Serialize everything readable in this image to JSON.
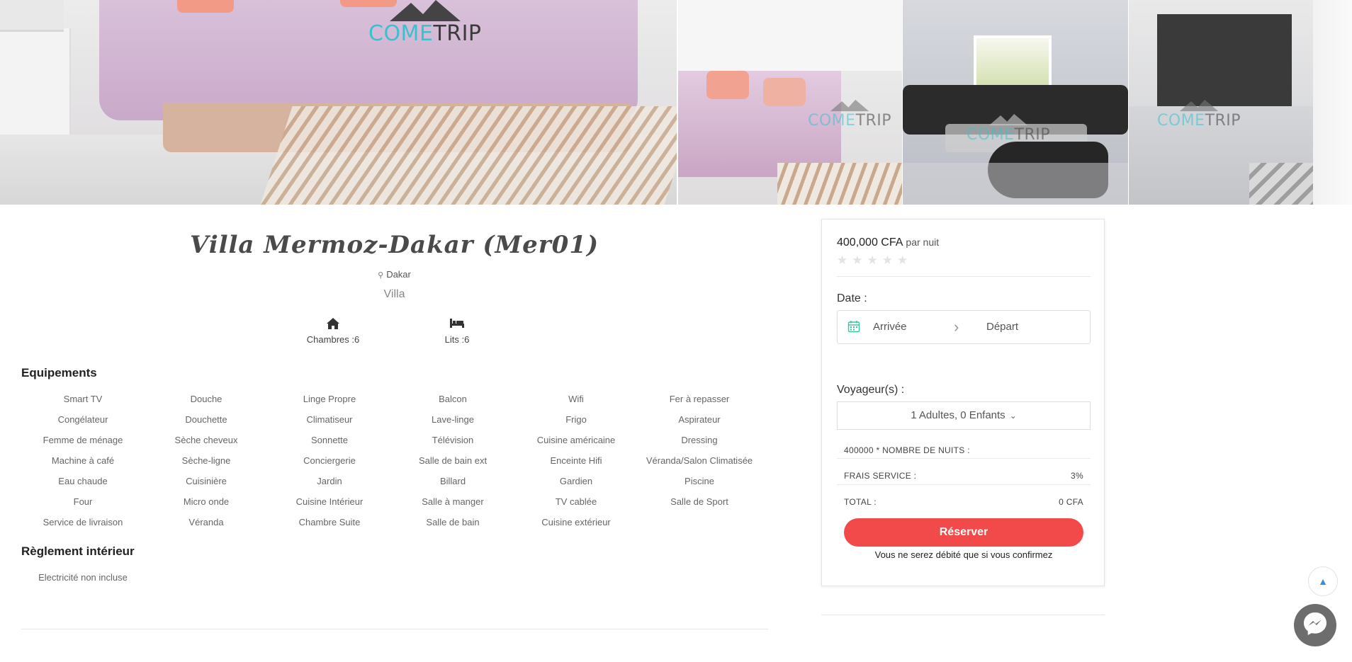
{
  "brand": {
    "name_part1": "COME",
    "name_part2": "TRIP"
  },
  "gallery": {
    "photos": [
      "bedroom",
      "bedroom",
      "living-room",
      "bedroom"
    ]
  },
  "listing": {
    "title": "Villa Mermoz-Dakar (Mer01)",
    "location": "Dakar",
    "type": "Villa",
    "rooms_label": "Chambres :6",
    "beds_label": "Lits :6"
  },
  "amenities": {
    "heading": "Equipements",
    "items": [
      "Smart TV",
      "Douche",
      "Linge Propre",
      "Balcon",
      "Wifi",
      "Fer à repasser",
      "Congélateur",
      "Douchette",
      "Climatiseur",
      "Lave-linge",
      "Frigo",
      "Aspirateur",
      "Femme de ménage",
      "Sèche cheveux",
      "Sonnette",
      "Télévision",
      "Cuisine américaine",
      "Dressing",
      "Machine à café",
      "Sèche-ligne",
      "Conciergerie",
      "Salle de bain ext",
      "Enceinte Hifi",
      "Véranda/Salon Climatisée",
      "Eau chaude",
      "Cuisinière",
      "Jardin",
      "Billard",
      "Gardien",
      "Piscine",
      "Four",
      "Micro onde",
      "Cuisine Intérieur",
      "Salle à manger",
      "TV cablée",
      "Salle de Sport",
      "Service de livraison",
      "Véranda",
      "Chambre Suite",
      "Salle de bain",
      "Cuisine extérieur"
    ]
  },
  "rules": {
    "heading": "Règlement intérieur",
    "items": [
      "Electricité non incluse"
    ]
  },
  "booking": {
    "price": "400,000 CFA",
    "per_night": "par nuit",
    "rating": 0,
    "stars": "★★★★★",
    "date_label": "Date :",
    "arrival_placeholder": "Arrivée",
    "departure_placeholder": "Départ",
    "travellers_label": "Voyageur(s) :",
    "travellers_value": "1 Adultes, 0 Enfants",
    "nights_label": "400000 * NOMBRE DE NUITS :",
    "nights_value": "",
    "fee_label": "FRAIS SERVICE :",
    "fee_value": "3%",
    "total_label": "TOTAL :",
    "total_value": "0 CFA",
    "reserve_label": "Réserver",
    "note": "Vous ne serez débité que si vous confirmez"
  },
  "colors": {
    "accent": "#f24a4a",
    "brand_teal": "#3cc0cf",
    "star_empty": "#e3e3e3"
  }
}
